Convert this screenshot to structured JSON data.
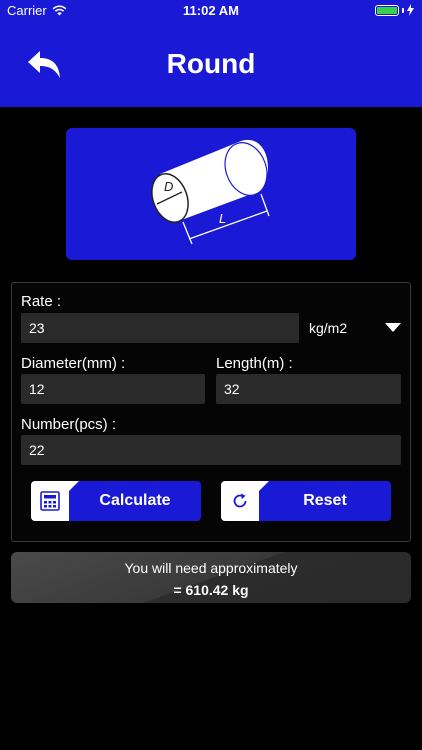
{
  "status_bar": {
    "carrier": "Carrier",
    "time": "11:02 AM",
    "battery_color": "#38d14a"
  },
  "nav": {
    "title": "Round",
    "back_icon": "back-arrow-icon"
  },
  "illustration": {
    "diameter_letter": "D",
    "length_letter": "L"
  },
  "form": {
    "rate_label": "Rate :",
    "rate_value": "23",
    "rate_unit": "kg/m2",
    "diameter_label": "Diameter(mm) :",
    "diameter_value": "12",
    "length_label": "Length(m) :",
    "length_value": "32",
    "number_label": "Number(pcs) :",
    "number_value": "22"
  },
  "buttons": {
    "calculate_label": "Calculate",
    "calculate_icon": "calculator-icon",
    "reset_label": "Reset",
    "reset_icon": "refresh-icon"
  },
  "result": {
    "caption": "You will need approximately",
    "value": "= 610.42 kg"
  },
  "colors": {
    "accent": "#1a1ad6",
    "background": "#000000",
    "field": "#2a2a2a"
  }
}
